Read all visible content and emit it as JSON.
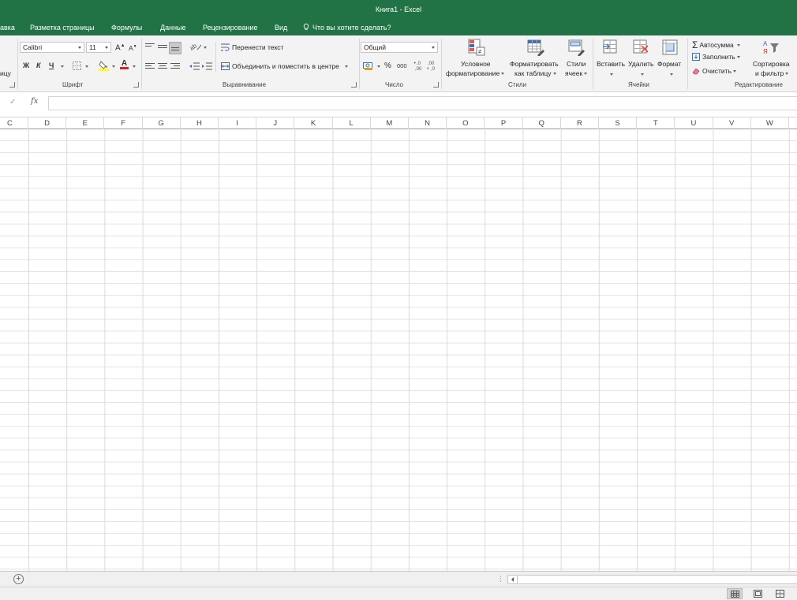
{
  "window": {
    "title": "Книга1 - Excel"
  },
  "tabs": {
    "vstavka_partial": "авка",
    "razmetka": "Разметка страницы",
    "formuly": "Формулы",
    "dannye": "Данные",
    "recenz": "Рецензирование",
    "vid": "Вид",
    "tellme": "Что вы хотите сделать?"
  },
  "ribbon": {
    "clipboard_partial": "ицу",
    "font": {
      "name": "Calibri",
      "size": "11",
      "grow": "A",
      "shrink": "A",
      "bold": "Ж",
      "italic": "К",
      "underline": "Ч",
      "color_letter": "A",
      "group_label": "Шрифт"
    },
    "alignment": {
      "wrap_text": "Перенести текст",
      "merge_center": "Объединить и поместить в центре",
      "group_label": "Выравнивание"
    },
    "number": {
      "format": "Общий",
      "percent": "%",
      "thousands": "000",
      "inc_decimal": ",0 ,00",
      "group_label": "Число"
    },
    "styles": {
      "conditional_1": "Условное",
      "conditional_2": "форматирование",
      "format_table_1": "Форматировать",
      "format_table_2": "как таблицу",
      "cell_styles_1": "Стили",
      "cell_styles_2": "ячеек",
      "group_label": "Стили"
    },
    "cells": {
      "insert": "Вставить",
      "delete": "Удалить",
      "format": "Формат",
      "group_label": "Ячейки"
    },
    "editing": {
      "autosum": "Автосумма",
      "fill": "Заполнить",
      "clear": "Очистить",
      "sort_1": "Сортировка",
      "sort_2": "и фильтр",
      "group_label": "Редактирование"
    }
  },
  "formula_bar": {
    "check": "✓",
    "fx": "fx",
    "value": ""
  },
  "columns": [
    "C",
    "D",
    "E",
    "F",
    "G",
    "H",
    "I",
    "J",
    "K",
    "L",
    "M",
    "N",
    "O",
    "P",
    "Q",
    "R",
    "S",
    "T",
    "U",
    "V",
    "W"
  ],
  "sheetbar": {
    "add": "+",
    "dots": "⋮"
  },
  "colors": {
    "accent": "#217346",
    "ribbon_bg": "#f3f3f3",
    "gridline": "#dadada",
    "font_color_bar": "#e02020",
    "highlight_bar": "#ffff00"
  }
}
